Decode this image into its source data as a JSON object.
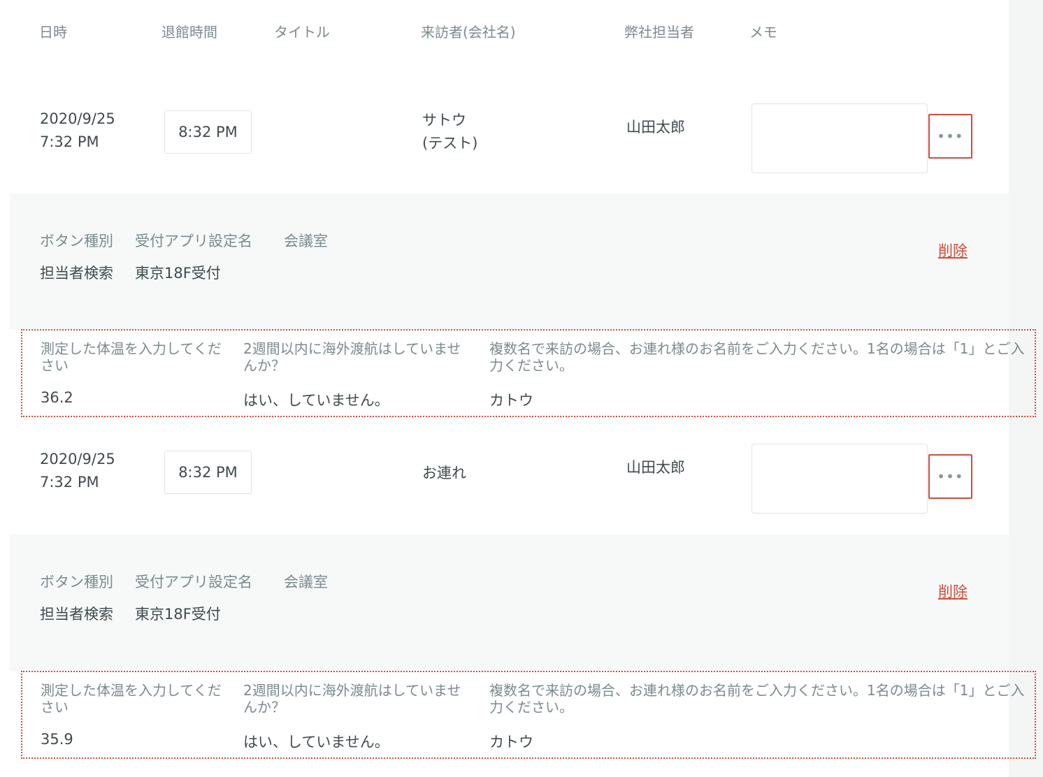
{
  "header": {
    "datetime": "日時",
    "exit_time": "退館時間",
    "title": "タイトル",
    "visitor": "来訪者(会社名)",
    "staff": "弊社担当者",
    "memo": "メモ"
  },
  "rows": [
    {
      "date": "2020/9/25",
      "time": "7:32 PM",
      "exit_time": "8:32 PM",
      "visitor_line1": "サトウ",
      "visitor_line2": "(テスト)",
      "staff": "山田太郎",
      "more": "•••",
      "detail": {
        "label_button_type": "ボタン種別",
        "label_app_setting": "受付アプリ設定名",
        "label_room": "会議室",
        "value_button_type": "担当者検索",
        "value_app_setting": "東京18F受付",
        "delete": "削除"
      },
      "qa": {
        "q1": "測定した体温を入力してください",
        "a1": "36.2",
        "q2": "2週間以内に海外渡航はしていませんか？",
        "a2": "はい、していません。",
        "q3": "複数名で来訪の場合、お連れ様のお名前をご入力ください。1名の場合は「1」とご入力ください。",
        "a3": "カトウ"
      }
    },
    {
      "date": "2020/9/25",
      "time": "7:32 PM",
      "exit_time": "8:32 PM",
      "visitor_line1": "お連れ",
      "visitor_line2": "",
      "staff": "山田太郎",
      "more": "•••",
      "detail": {
        "label_button_type": "ボタン種別",
        "label_app_setting": "受付アプリ設定名",
        "label_room": "会議室",
        "value_button_type": "担当者検索",
        "value_app_setting": "東京18F受付",
        "delete": "削除"
      },
      "qa": {
        "q1": "測定した体温を入力してください",
        "a1": "35.9",
        "q2": "2週間以内に海外渡航はしていませんか？",
        "a2": "はい、していません。",
        "q3": "複数名で来訪の場合、お連れ様のお名前をご入力ください。1名の場合は「1」とご入力ください。",
        "a3": "カトウ"
      }
    }
  ],
  "colors": {
    "highlight": "#d44a3a",
    "panel_bg": "#f7f9f9",
    "label": "#7b8a8e",
    "text": "#3f4a4d"
  }
}
